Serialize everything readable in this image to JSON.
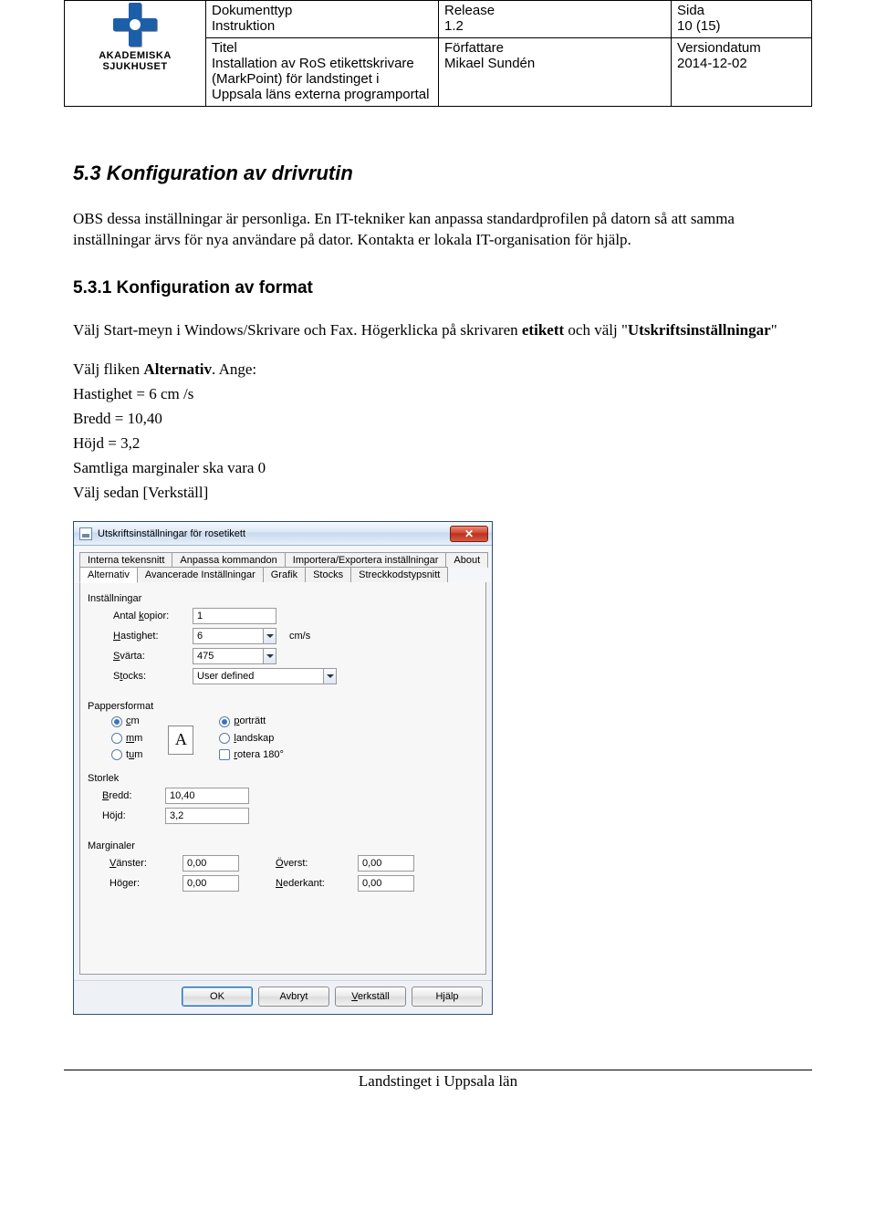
{
  "header": {
    "logo_line1": "AKADEMISKA",
    "logo_line2": "SJUKHUSET",
    "doc_type_label": "Dokumenttyp",
    "doc_type_value": "Instruktion",
    "release_label": "Release",
    "release_value": "1.2",
    "page_label": "Sida",
    "page_value": "10 (15)",
    "title_label": "Titel",
    "title_value": "Installation av RoS etikettskrivare (MarkPoint) för landstinget i Uppsala läns externa programportal",
    "author_label": "Författare",
    "author_value": "Mikael Sundén",
    "verdate_label": "Versiondatum",
    "verdate_value": "2014-12-02"
  },
  "doc": {
    "h53": "5.3  Konfiguration av drivrutin",
    "p1": "OBS dessa inställningar är personliga. En IT-tekniker kan anpassa standardprofilen på datorn så att samma inställningar ärvs för nya användare på dator. Kontakta er lokala IT-organisation för hjälp.",
    "h531": "5.3.1  Konfiguration av format",
    "p2a": "Välj Start-meyn i Windows/Skrivare och Fax. Högerklicka på skrivaren ",
    "p2b_bold": "etikett",
    "p2c": " och välj \"",
    "p2d_bold": "Utskriftsinställningar",
    "p2e": "\"",
    "p3a": "Välj fliken ",
    "p3b_bold": "Alternativ",
    "p3c": ". Ange:",
    "p4": "Hastighet = 6 cm /s",
    "p5": "Bredd = 10,40",
    "p6": "Höjd = 3,2",
    "p7": "Samtliga marginaler ska vara 0",
    "p8": "Välj sedan [Verkställ]"
  },
  "dlg": {
    "title": "Utskriftsinställningar för rosetikett",
    "tabs_row1": [
      "Interna tekensnitt",
      "Anpassa kommandon",
      "Importera/Exportera inställningar",
      "About"
    ],
    "tabs_row2": [
      "Alternativ",
      "Avancerade Inställningar",
      "Grafik",
      "Stocks",
      "Streckkodstypsnitt"
    ],
    "active_tab": "Alternativ",
    "grp_settings": "Inställningar",
    "lbl_copies": "Antal kopior:",
    "val_copies": "1",
    "lbl_speed": "Hastighet:",
    "val_speed": "6",
    "unit_speed": "cm/s",
    "lbl_dark": "Svärta:",
    "val_dark": "475",
    "lbl_stocks": "Stocks:",
    "val_stocks": "User defined",
    "grp_paper": "Pappersformat",
    "radio_cm": "cm",
    "radio_mm": "mm",
    "radio_in": "tum",
    "radio_port": "porträtt",
    "radio_land": "landskap",
    "chk_rot": "rotera 180°",
    "grp_size": "Storlek",
    "lbl_width": "Bredd:",
    "val_width": "10,40",
    "lbl_height": "Höjd:",
    "val_height": "3,2",
    "grp_margin": "Marginaler",
    "lbl_left": "Vänster:",
    "lbl_right": "Höger:",
    "lbl_top": "Överst:",
    "lbl_bottom": "Nederkant:",
    "val_margin": "0,00",
    "btn_ok": "OK",
    "btn_cancel": "Avbryt",
    "btn_apply": "Verkställ",
    "btn_help": "Hjälp"
  },
  "footer": "Landstinget i Uppsala län"
}
